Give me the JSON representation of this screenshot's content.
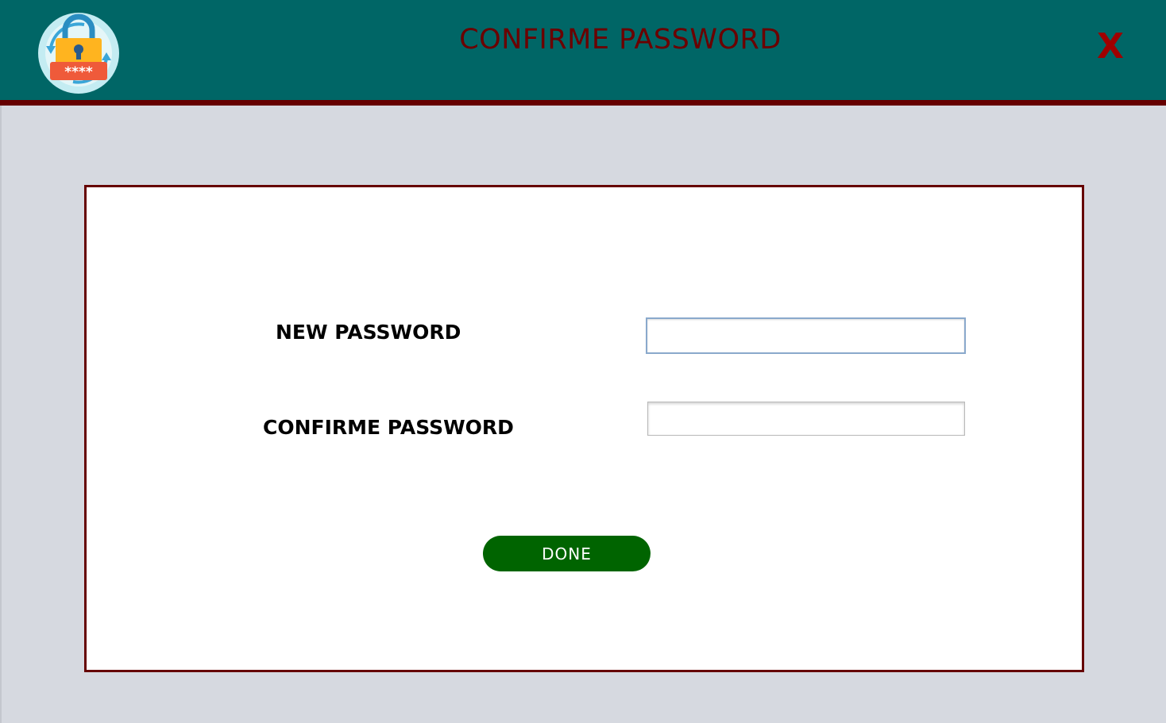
{
  "header": {
    "title": "CONFIRME PASSWORD",
    "close_label": "X",
    "logo_icon": "lock-password-reset-icon",
    "logo_text": "****",
    "background_color": "#006666",
    "accent_color": "#660000"
  },
  "form": {
    "new_password_label": "NEW PASSWORD",
    "new_password_value": "",
    "confirm_password_label": "CONFIRME PASSWORD",
    "confirm_password_value": "",
    "done_label": "DONE",
    "done_color": "#006400"
  }
}
